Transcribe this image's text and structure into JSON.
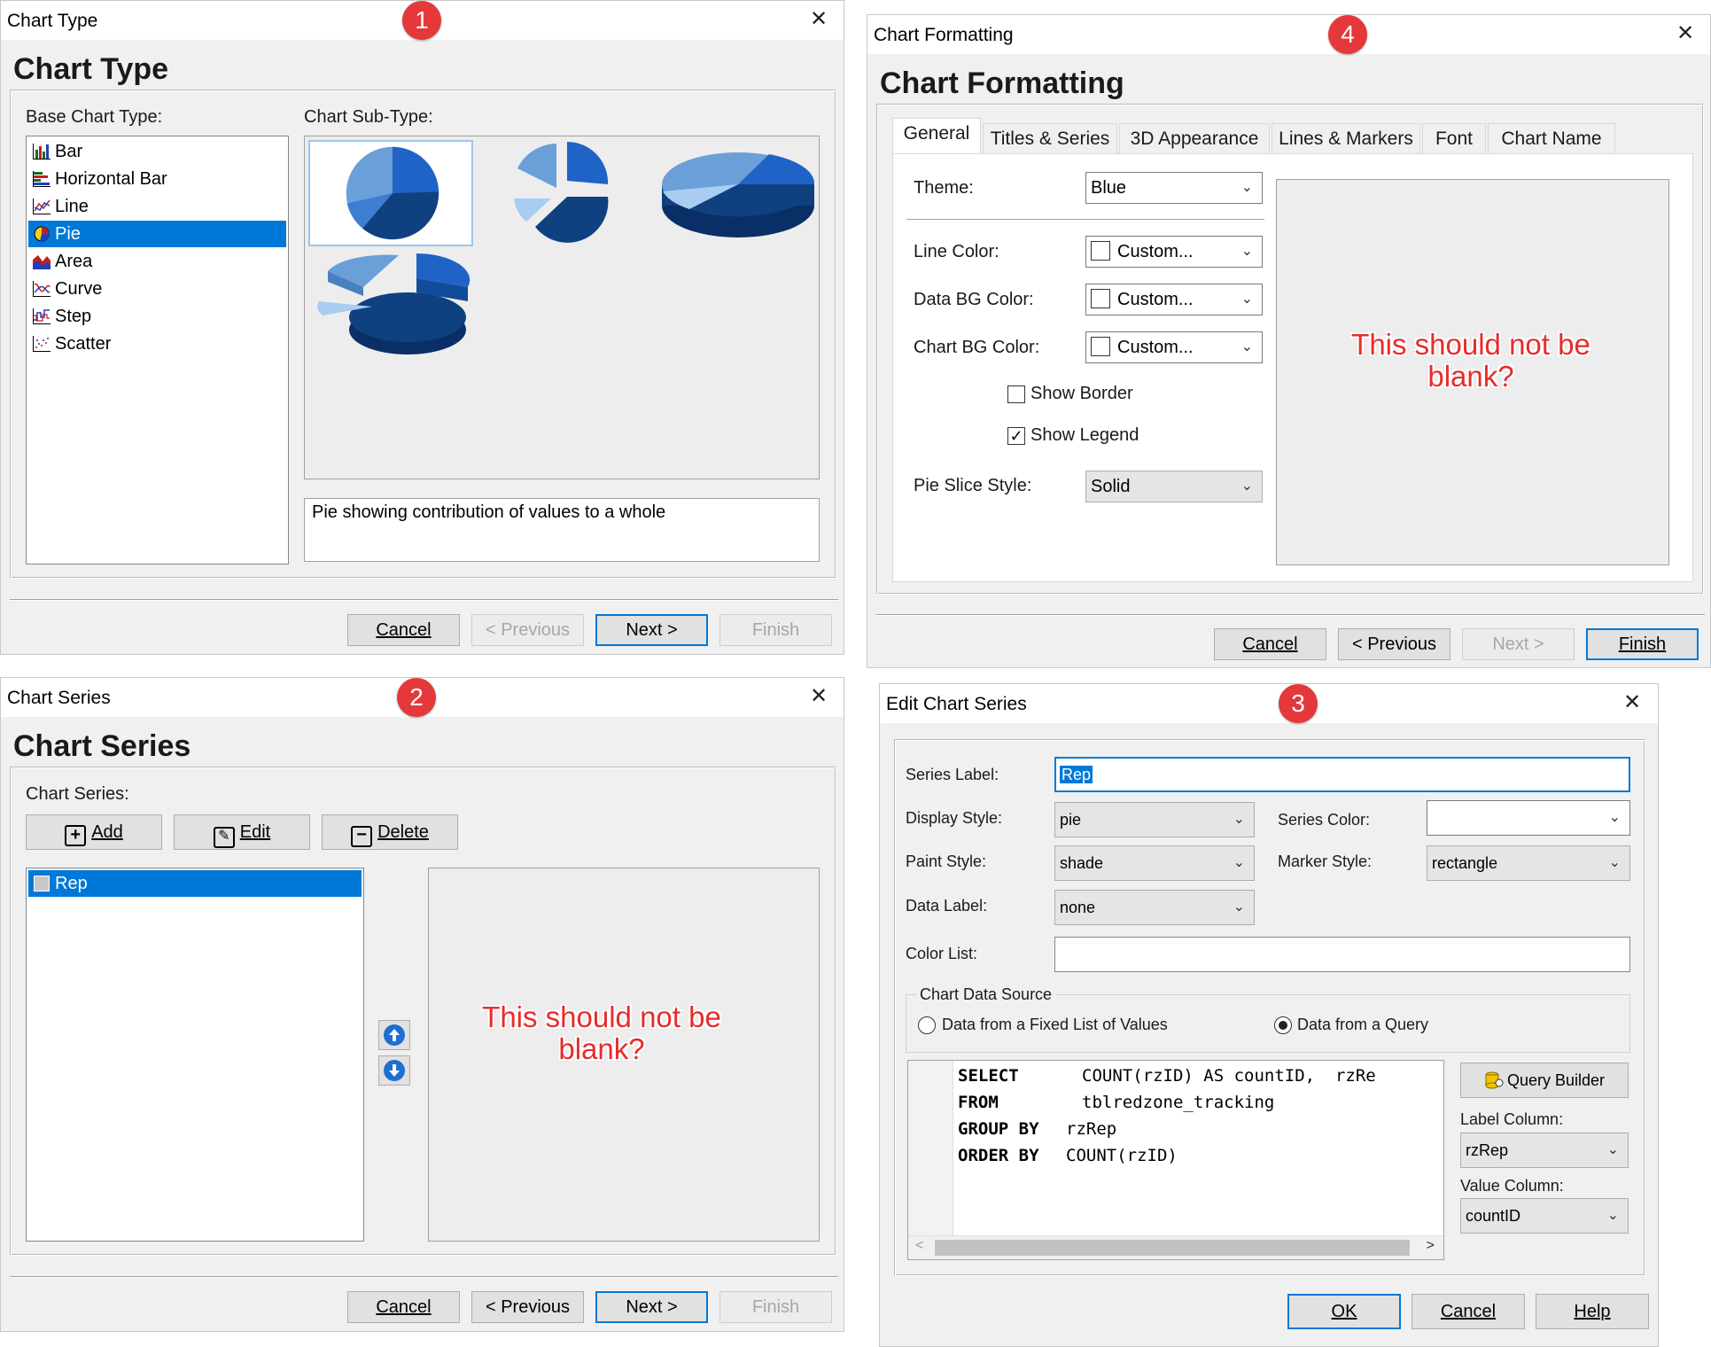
{
  "markers": {
    "d1": "1",
    "d2": "2",
    "d3": "3",
    "d4": "4"
  },
  "close_glyph": "✕",
  "d1": {
    "window_title": "Chart Type",
    "heading": "Chart Type",
    "base_label": "Base Chart Type:",
    "subtype_label": "Chart Sub-Type:",
    "types": [
      "Bar",
      "Horizontal Bar",
      "Line",
      "Pie",
      "Area",
      "Curve",
      "Step",
      "Scatter"
    ],
    "selected_type": "Pie",
    "description": "Pie showing contribution of values to a whole",
    "buttons": {
      "cancel": "Cancel",
      "previous": "< Previous",
      "next": "Next >",
      "finish": "Finish"
    }
  },
  "d2": {
    "window_title": "Chart Series",
    "heading": "Chart Series",
    "series_label": "Chart Series:",
    "add": "Add",
    "edit": "Edit",
    "delete": "Delete",
    "series": [
      "Rep"
    ],
    "note": "This should not be blank?",
    "buttons": {
      "cancel": "Cancel",
      "previous": "< Previous",
      "next": "Next >",
      "finish": "Finish"
    }
  },
  "d3": {
    "window_title": "Edit Chart Series",
    "series_label_lbl": "Series Label:",
    "series_label_val": "Rep",
    "display_style_lbl": "Display Style:",
    "display_style_val": "pie",
    "series_color_lbl": "Series Color:",
    "series_color_val": "",
    "paint_style_lbl": "Paint Style:",
    "paint_style_val": "shade",
    "marker_style_lbl": "Marker Style:",
    "marker_style_val": "rectangle",
    "data_label_lbl": "Data Label:",
    "data_label_val": "none",
    "color_list_lbl": "Color List:",
    "color_list_val": "",
    "source_group": "Chart Data Source",
    "opt_fixed": "Data from a Fixed List of Values",
    "opt_query": "Data from a Query",
    "sql": [
      {
        "kw": "SELECT",
        "rest": "COUNT(rzID) AS countID,  rzRe"
      },
      {
        "kw": "FROM",
        "rest": "tblredzone_tracking"
      },
      {
        "kw": "GROUP BY",
        "rest": "rzRep"
      },
      {
        "kw": "ORDER BY",
        "rest": "COUNT(rzID)"
      }
    ],
    "query_builder": "Query Builder",
    "label_column_lbl": "Label Column:",
    "label_column_val": "rzRep",
    "value_column_lbl": "Value Column:",
    "value_column_val": "countID",
    "buttons": {
      "ok": "OK",
      "cancel": "Cancel",
      "help": "Help"
    }
  },
  "d4": {
    "window_title": "Chart Formatting",
    "heading": "Chart Formatting",
    "tabs": [
      "General",
      "Titles & Series",
      "3D Appearance",
      "Lines & Markers",
      "Font",
      "Chart Name"
    ],
    "theme_lbl": "Theme:",
    "theme_val": "Blue",
    "line_color_lbl": "Line Color:",
    "line_color_val": "Custom...",
    "data_bg_lbl": "Data BG Color:",
    "data_bg_val": "Custom...",
    "chart_bg_lbl": "Chart BG Color:",
    "chart_bg_val": "Custom...",
    "show_border": "Show Border",
    "show_border_checked": false,
    "show_legend": "Show Legend",
    "show_legend_checked": true,
    "pie_slice_lbl": "Pie Slice Style:",
    "pie_slice_val": "Solid",
    "note": "This should not be blank?",
    "buttons": {
      "cancel": "Cancel",
      "previous": "< Previous",
      "next": "Next >",
      "finish": "Finish"
    }
  }
}
